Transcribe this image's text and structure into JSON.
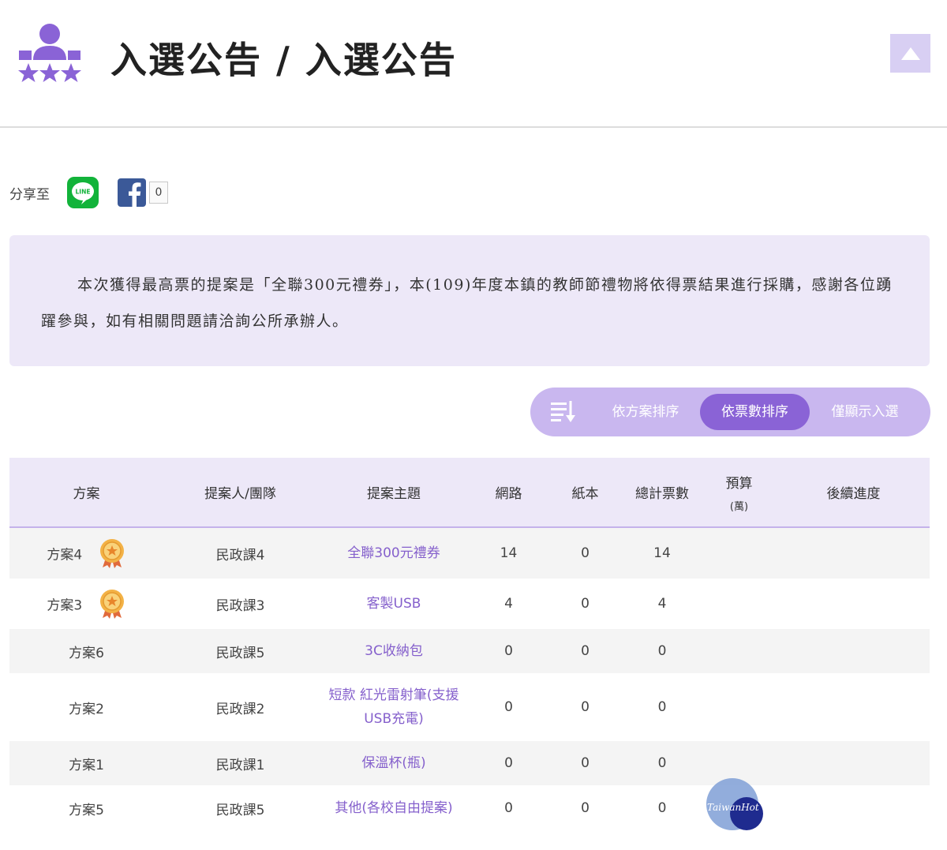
{
  "header": {
    "title": "入選公告 / 入選公告",
    "logo_icon": "voting-people-stars-icon",
    "top_button_icon": "triangle-up-icon"
  },
  "share": {
    "label": "分享至",
    "line_label": "LINE",
    "fb_count": "0"
  },
  "notice": {
    "text": "本次獲得最高票的提案是「全聯300元禮券」，本(109)年度本鎮的教師節禮物將依得票結果進行採購，感謝各位踴躍參與，如有相關問題請洽詢公所承辦人。"
  },
  "sortbar": {
    "buttons": [
      {
        "label": "依方案排序",
        "active": false
      },
      {
        "label": "依票數排序",
        "active": true
      },
      {
        "label": "僅顯示入選",
        "active": false
      }
    ]
  },
  "table": {
    "headers": {
      "case": "方案",
      "proposer": "提案人/團隊",
      "topic": "提案主題",
      "online": "網路",
      "paper": "紙本",
      "total": "總計票數",
      "budget": "預算",
      "budget_unit": "(萬)",
      "progress": "後續進度"
    },
    "rows": [
      {
        "case": "方案4",
        "medal": true,
        "proposer": "民政課4",
        "topic": "全聯300元禮券",
        "online": "14",
        "paper": "0",
        "total": "14",
        "budget": "",
        "progress": ""
      },
      {
        "case": "方案3",
        "medal": true,
        "proposer": "民政課3",
        "topic": "客製USB",
        "online": "4",
        "paper": "0",
        "total": "4",
        "budget": "",
        "progress": ""
      },
      {
        "case": "方案6",
        "medal": false,
        "proposer": "民政課5",
        "topic": "3C收納包",
        "online": "0",
        "paper": "0",
        "total": "0",
        "budget": "",
        "progress": ""
      },
      {
        "case": "方案2",
        "medal": false,
        "proposer": "民政課2",
        "topic": "短款 紅光雷射筆(支援USB充電)",
        "online": "0",
        "paper": "0",
        "total": "0",
        "budget": "",
        "progress": ""
      },
      {
        "case": "方案1",
        "medal": false,
        "proposer": "民政課1",
        "topic": "保溫杯(瓶)",
        "online": "0",
        "paper": "0",
        "total": "0",
        "budget": "",
        "progress": ""
      },
      {
        "case": "方案5",
        "medal": false,
        "proposer": "民政課5",
        "topic": "其他(各校自由提案)",
        "online": "0",
        "paper": "0",
        "total": "0",
        "budget": "",
        "progress": ""
      }
    ]
  },
  "watermark": {
    "text": "TaiwanHot"
  },
  "colors": {
    "accent": "#8a63d6",
    "sortbar": "#c9b7ef",
    "light_purple": "#ede8f8",
    "topic_link": "#8560cc"
  }
}
